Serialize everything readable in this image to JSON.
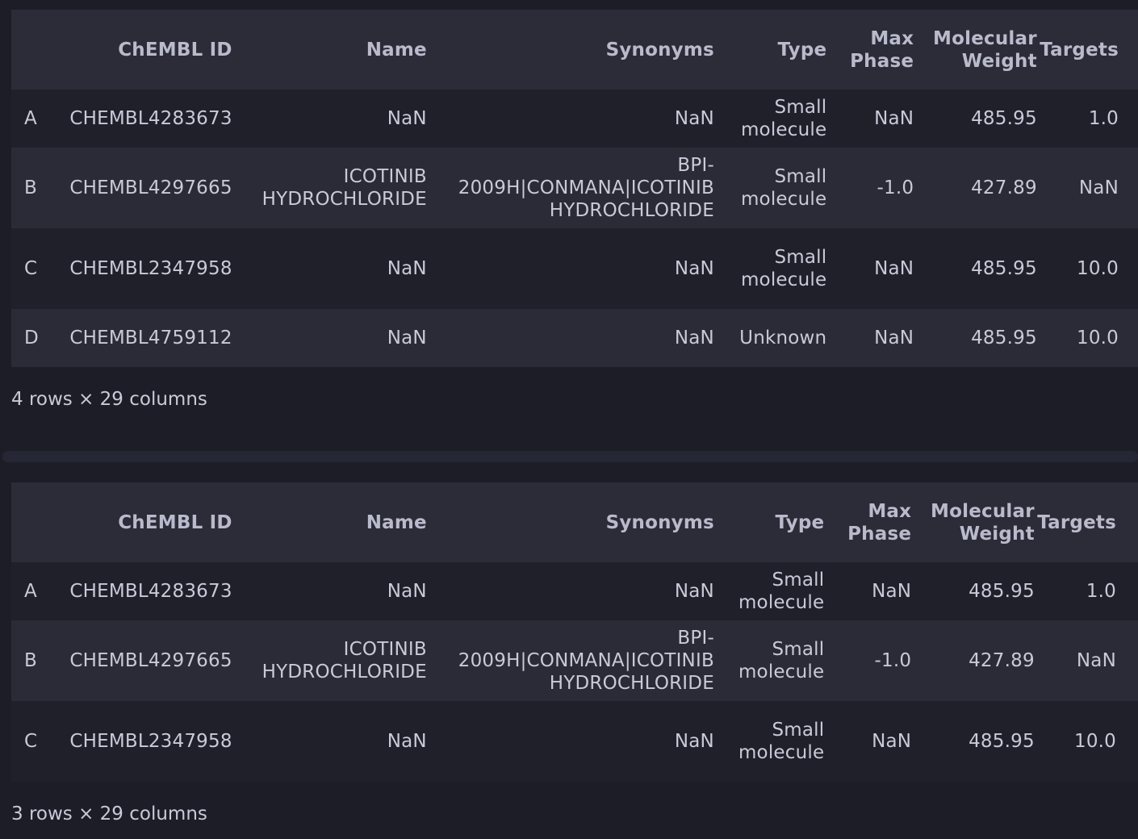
{
  "tables": [
    {
      "columns": [
        "",
        "ChEMBL ID",
        "Name",
        "Synonyms",
        "Type",
        "Max Phase",
        "Molecular Weight",
        "Targets"
      ],
      "rows": [
        [
          "A",
          "CHEMBL4283673",
          "NaN",
          "NaN",
          "Small molecule",
          "NaN",
          "485.95",
          "1.0"
        ],
        [
          "B",
          "CHEMBL4297665",
          "ICOTINIB HYDROCHLORIDE",
          "BPI-2009H|CONMANA|ICOTINIB HYDROCHLORIDE",
          "Small molecule",
          "-1.0",
          "427.89",
          "NaN"
        ],
        [
          "C",
          "CHEMBL2347958",
          "NaN",
          "NaN",
          "Small molecule",
          "NaN",
          "485.95",
          "10.0"
        ],
        [
          "D",
          "CHEMBL4759112",
          "NaN",
          "NaN",
          "Unknown",
          "NaN",
          "485.95",
          "10.0"
        ]
      ],
      "shape": "4 rows × 29 columns"
    },
    {
      "columns": [
        "",
        "ChEMBL ID",
        "Name",
        "Synonyms",
        "Type",
        "Max Phase",
        "Molecular Weight",
        "Targets"
      ],
      "rows": [
        [
          "A",
          "CHEMBL4283673",
          "NaN",
          "NaN",
          "Small molecule",
          "NaN",
          "485.95",
          "1.0"
        ],
        [
          "B",
          "CHEMBL4297665",
          "ICOTINIB HYDROCHLORIDE",
          "BPI-2009H|CONMANA|ICOTINIB HYDROCHLORIDE",
          "Small molecule",
          "-1.0",
          "427.89",
          "NaN"
        ],
        [
          "C",
          "CHEMBL2347958",
          "NaN",
          "NaN",
          "Small molecule",
          "NaN",
          "485.95",
          "10.0"
        ]
      ],
      "shape": "3 rows × 29 columns"
    }
  ]
}
